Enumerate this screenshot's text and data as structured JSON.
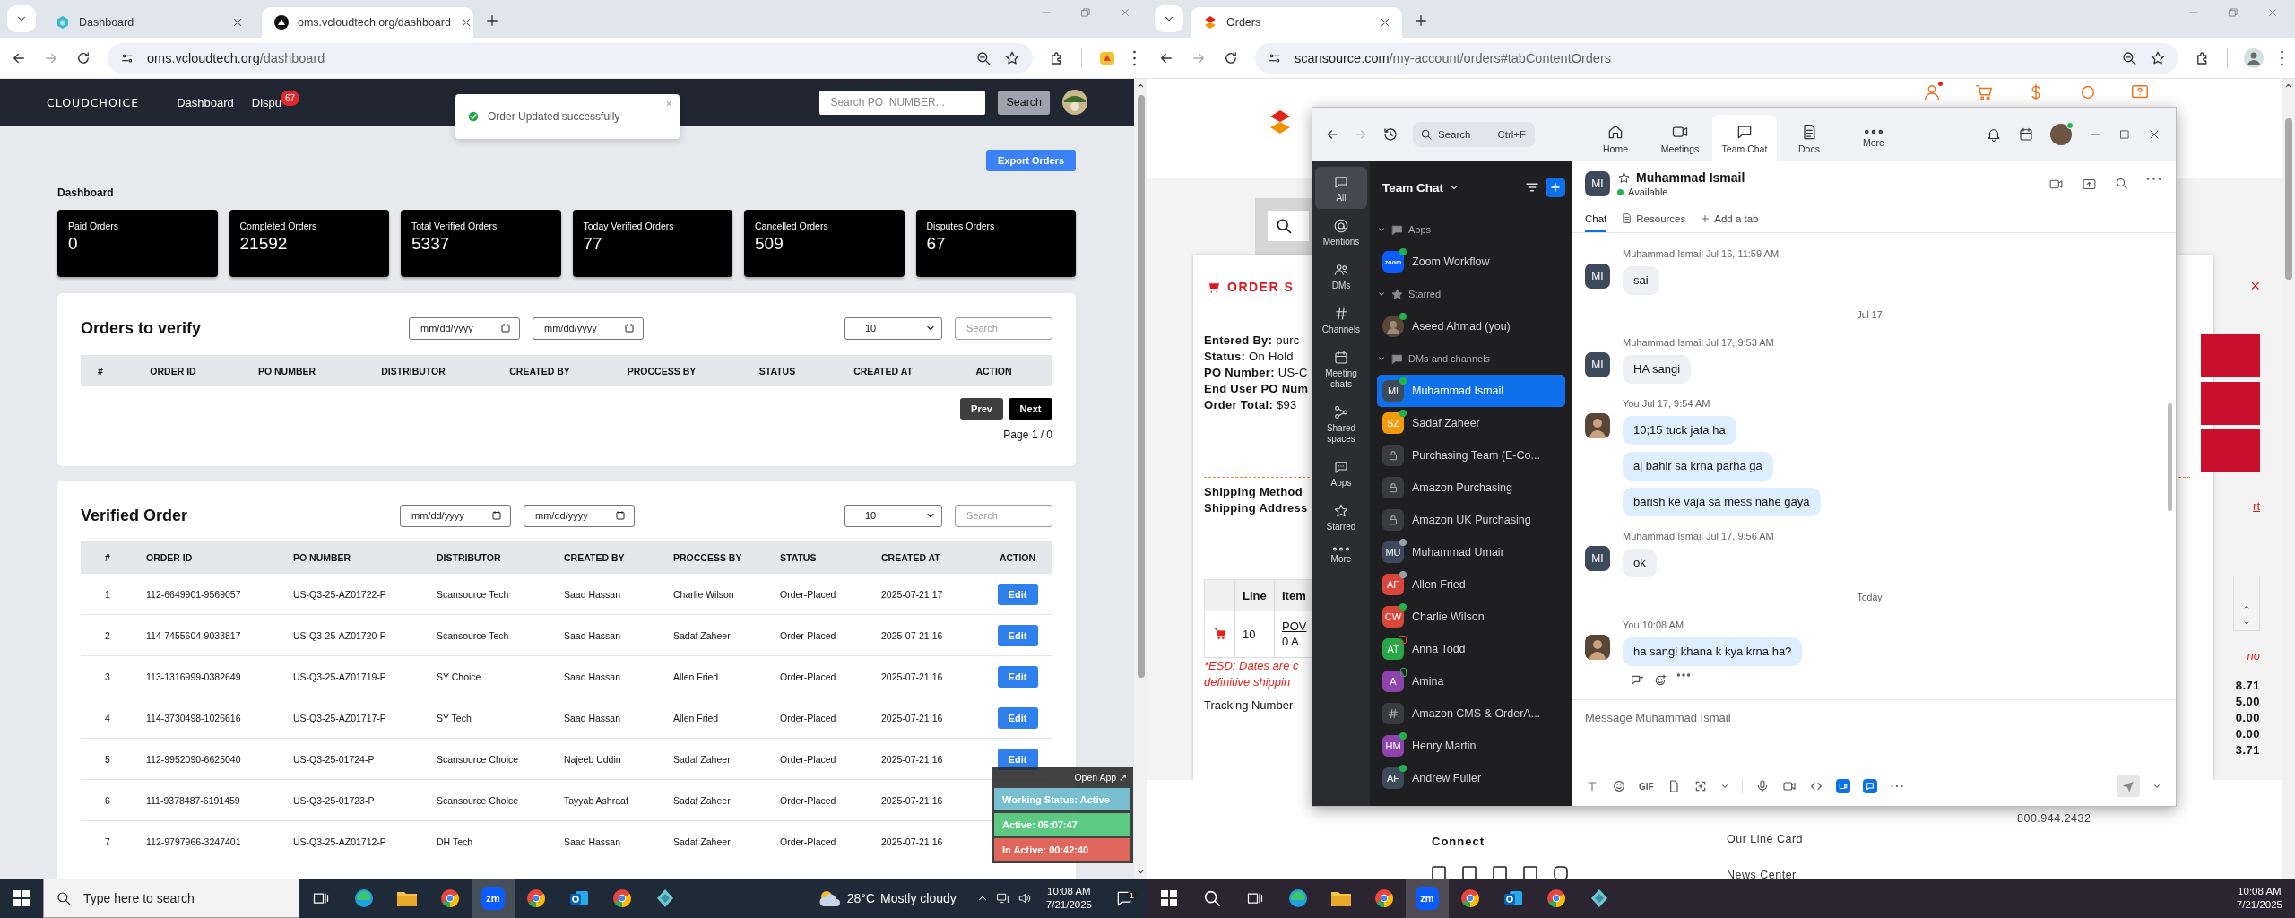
{
  "left_browser": {
    "tabs": [
      {
        "title": "Dashboard",
        "selected": false,
        "kind": "hexagon"
      },
      {
        "title": "oms.vcloudtech.org/dashboard",
        "selected": true,
        "kind": "triangle"
      }
    ],
    "address": {
      "host": "oms.vcloudtech.org",
      "path": "/dashboard"
    }
  },
  "oms": {
    "logo": "CLOUDCHOICE",
    "nav": [
      {
        "label": "Dashboard"
      },
      {
        "label": "Dispu",
        "badge": "67"
      }
    ],
    "search": {
      "placeholder": "Search PO_NUMBER...",
      "button": "Search"
    },
    "toast": {
      "message": "Order Updated successfully",
      "close": "×"
    },
    "export_button": "Export Orders",
    "heading": "Dashboard",
    "stats": [
      {
        "label": "Paid Orders",
        "value": "0"
      },
      {
        "label": "Completed Orders",
        "value": "21592"
      },
      {
        "label": "Total Verified Orders",
        "value": "5337"
      },
      {
        "label": "Today Verified Orders",
        "value": "77"
      },
      {
        "label": "Cancelled Orders",
        "value": "509"
      },
      {
        "label": "Disputes Orders",
        "value": "67"
      }
    ],
    "orders_to_verify": {
      "title": "Orders to verify",
      "date_from": {
        "placeholder": "mm/dd/yyyy"
      },
      "date_to": {
        "placeholder": "mm/dd/yyyy"
      },
      "page_size": "10",
      "search": {
        "placeholder": "Search"
      },
      "columns": [
        "#",
        "ORDER ID",
        "PO NUMBER",
        "DISTRIBUTOR",
        "CREATED BY",
        "PROCCESS BY",
        "STATUS",
        "CREATED AT",
        "ACTION"
      ],
      "prev": "Prev",
      "next": "Next",
      "page_info": "Page 1 / 0"
    },
    "verified_orders": {
      "title": "Verified Order",
      "date_from": {
        "placeholder": "mm/dd/yyyy"
      },
      "date_to": {
        "placeholder": "mm/dd/yyyy"
      },
      "page_size": "10",
      "search": {
        "placeholder": "Search"
      },
      "columns": [
        "#",
        "ORDER ID",
        "PO NUMBER",
        "DISTRIBUTOR",
        "CREATED BY",
        "PROCCESS BY",
        "STATUS",
        "CREATED AT",
        "ACTION"
      ],
      "rows": [
        {
          "number": "1",
          "order_id": "112-6649901-9569057",
          "po_number": "US-Q3-25-AZ01722-P",
          "distributor": "Scansource Tech",
          "created_by": "Saad Hassan",
          "processed_by": "Charlie Wilson",
          "status": "Order-Placed",
          "created_at": "2025-07-21 17",
          "action": "Edit"
        },
        {
          "number": "2",
          "order_id": "114-7455604-9033817",
          "po_number": "US-Q3-25-AZ01720-P",
          "distributor": "Scansource Tech",
          "created_by": "Saad Hassan",
          "processed_by": "Sadaf Zaheer",
          "status": "Order-Placed",
          "created_at": "2025-07-21 16",
          "action": "Edit"
        },
        {
          "number": "3",
          "order_id": "113-1316999-0382649",
          "po_number": "US-Q3-25-AZ01719-P",
          "distributor": "SY Choice",
          "created_by": "Saad Hassan",
          "processed_by": "Allen Fried",
          "status": "Order-Placed",
          "created_at": "2025-07-21 16",
          "action": "Edit"
        },
        {
          "number": "4",
          "order_id": "114-3730498-1026616",
          "po_number": "US-Q3-25-AZ01717-P",
          "distributor": "SY Tech",
          "created_by": "Saad Hassan",
          "processed_by": "Allen Fried",
          "status": "Order-Placed",
          "created_at": "2025-07-21 16",
          "action": "Edit"
        },
        {
          "number": "5",
          "order_id": "112-9952090-6625040",
          "po_number": "US-Q3-25-01724-P",
          "distributor": "Scansource Choice",
          "created_by": "Najeeb Uddin",
          "processed_by": "Sadaf Zaheer",
          "status": "Order-Placed",
          "created_at": "2025-07-21 16",
          "action": "Edit"
        },
        {
          "number": "6",
          "order_id": "111-9378487-6191459",
          "po_number": "US-Q3-25-01723-P",
          "distributor": "Scansource Choice",
          "created_by": "Tayyab Ashraaf",
          "processed_by": "Sadaf Zaheer",
          "status": "Order-Placed",
          "created_at": "2025-07-21 16"
        },
        {
          "number": "7",
          "order_id": "112-9797966-3247401",
          "po_number": "US-Q3-25-AZ01712-P",
          "distributor": "DH Tech",
          "created_by": "Saad Hassan",
          "processed_by": "Sadaf Zaheer",
          "status": "Order-Placed",
          "created_at": "2025-07-21 16"
        }
      ]
    },
    "activity_widget": {
      "open_app": "Open App ↗",
      "working_status": "Working Status: Active",
      "active": "Active: 06:07:47",
      "inactive": "In Active: 00:42:40"
    }
  },
  "right_browser": {
    "tabs": [
      {
        "title": "Orders",
        "selected": true,
        "kind": "scansource"
      }
    ],
    "address": {
      "host": "scansource.com",
      "path": "/my-account/orders#tabContentOrders"
    }
  },
  "scansource": {
    "order_title": "ORDER S",
    "close": "×",
    "details": [
      {
        "label": "Entered By:",
        "value": "purc"
      },
      {
        "label": "Status:",
        "value": "On Hold"
      },
      {
        "label": "PO Number:",
        "value": "US-C"
      },
      {
        "label": "End User PO Num"
      },
      {
        "label": "Order Total:",
        "value": "$93"
      }
    ],
    "shipping": [
      "Shipping Method",
      "Shipping Address"
    ],
    "link_fragment": "rt",
    "table": {
      "columns": [
        "Line",
        "Item"
      ],
      "rows": [
        {
          "line": "10",
          "item": "POV",
          "item_note": "0 A"
        }
      ]
    },
    "esd_note": [
      "*ESD: Dates are c",
      "definitive shippin"
    ],
    "right_note": "no",
    "tracking": "Tracking Number",
    "totals": [
      "8.71",
      "5.00",
      "0.00",
      "0.00",
      "3.71"
    ],
    "phone": "800.944.2432",
    "connect": "Connect",
    "footer_links": [
      "Our Line Card",
      "News Center"
    ]
  },
  "zoom": {
    "search": {
      "placeholder": "Search",
      "shortcut": "Ctrl+F"
    },
    "tabs": [
      {
        "label": "Home",
        "kind": "home",
        "selected": false
      },
      {
        "label": "Meetings",
        "kind": "video",
        "selected": false
      },
      {
        "label": "Team Chat",
        "kind": "chat",
        "selected": true
      },
      {
        "label": "Docs",
        "kind": "doc",
        "selected": false
      },
      {
        "label": "More",
        "kind": "more",
        "selected": false
      }
    ],
    "rail": [
      {
        "label": "All",
        "kind": "chat",
        "selected": true
      },
      {
        "label": "Mentions",
        "kind": "at",
        "selected": false
      },
      {
        "label": "DMs",
        "kind": "people",
        "selected": false
      },
      {
        "label": "Channels",
        "kind": "hash",
        "selected": false
      },
      {
        "label": "Meeting chats",
        "kind": "calendar",
        "selected": false
      },
      {
        "label": "Shared spaces",
        "kind": "share",
        "selected": false
      },
      {
        "label": "Apps",
        "kind": "apps",
        "selected": false
      },
      {
        "label": "Starred",
        "kind": "star",
        "selected": false
      },
      {
        "label": "More",
        "kind": "more",
        "selected": false
      }
    ],
    "sidebar": {
      "title": "Team Chat",
      "sections": [
        {
          "title": "Apps",
          "kind": "apps",
          "items": [
            {
              "name": "Zoom Workflow",
              "kind": "app",
              "initials": "zoom",
              "color": "#0b5cff",
              "presence": {
                "kind": "online",
                "color": "#21b34b"
              },
              "selected": false
            }
          ]
        },
        {
          "title": "Starred",
          "kind": "star",
          "items": [
            {
              "name": "Aseed Ahmad (you)",
              "kind": "photo",
              "presence": {
                "kind": "online",
                "color": "#21b34b"
              },
              "selected": false
            }
          ]
        },
        {
          "title": "DMs and channels",
          "kind": "chat",
          "items": [
            {
              "name": "Muhammad Ismail",
              "kind": "avatar",
              "initials": "MI",
              "color": "#3d4a5c",
              "presence": {
                "kind": "online",
                "color": "#21b34b"
              },
              "selected": true
            },
            {
              "name": "Sadaf Zaheer",
              "kind": "avatar",
              "initials": "SZ",
              "color": "#f29b0c",
              "presence": {
                "kind": "online",
                "color": "#21b34b"
              },
              "selected": false
            },
            {
              "name": "Purchasing Team (E-Co...",
              "kind": "private",
              "selected": false
            },
            {
              "name": "Amazon Purchasing",
              "kind": "private",
              "selected": false
            },
            {
              "name": "Amazon UK Purchasing",
              "kind": "private",
              "selected": false
            },
            {
              "name": "Muhammad Umair",
              "kind": "avatar",
              "initials": "MU",
              "color": "#3d4a5c",
              "presence": {
                "kind": "away",
                "color": "#9aa0a6"
              },
              "selected": false
            },
            {
              "name": "Allen Fried",
              "kind": "avatar",
              "initials": "AF",
              "color": "#d9453b",
              "presence": {
                "kind": "away",
                "color": "#9aa0a6"
              },
              "selected": false
            },
            {
              "name": "Charlie Wilson",
              "kind": "avatar",
              "initials": "CW",
              "color": "#d9453b",
              "presence": {
                "kind": "online",
                "color": "#21b34b"
              },
              "selected": false
            },
            {
              "name": "Anna Todd",
              "kind": "avatar",
              "initials": "AT",
              "color": "#27a745",
              "presence": {
                "kind": "meeting",
                "color": "#e0433a"
              },
              "selected": false
            },
            {
              "name": "Amina",
              "kind": "avatar",
              "initials": "A",
              "color": "#8e44ad",
              "presence": {
                "kind": "mobile",
                "color": "#21b34b"
              },
              "selected": false
            },
            {
              "name": "Amazon CMS & OrderA...",
              "kind": "channel",
              "selected": false
            },
            {
              "name": "Henry Martin",
              "kind": "avatar",
              "initials": "HM",
              "color": "#8e44ad",
              "presence": {
                "kind": "online",
                "color": "#21b34b"
              },
              "selected": false
            },
            {
              "name": "Andrew Fuller",
              "kind": "avatar",
              "initials": "AF",
              "color": "#3d4a5c",
              "presence": {
                "kind": "online",
                "color": "#21b34b"
              },
              "selected": false
            }
          ]
        }
      ]
    },
    "chat": {
      "contact": {
        "initials": "MI",
        "name": "Muhammad Ismail",
        "status": "Available"
      },
      "tabs": [
        {
          "label": "Chat",
          "selected": true
        },
        {
          "label": "Resources",
          "selected": false
        }
      ],
      "add_tab": "Add a tab",
      "messages": [
        {
          "kind": "message",
          "sender": "Muhammad Ismail",
          "time": "Jul 16, 11:59 AM",
          "from_me": false,
          "initials": "MI",
          "bubbles": [
            "sai"
          ]
        },
        {
          "kind": "date",
          "label": "Jul 17"
        },
        {
          "kind": "message",
          "sender": "Muhammad Ismail",
          "time": "Jul 17, 9:53 AM",
          "from_me": false,
          "initials": "MI",
          "bubbles": [
            "HA sangi"
          ]
        },
        {
          "kind": "message",
          "sender": "You",
          "time": "Jul 17, 9:54 AM",
          "from_me": true,
          "bubbles": [
            "10;15 tuck jata ha",
            "aj bahir sa krna parha ga",
            "barish ke vaja sa mess nahe gaya"
          ]
        },
        {
          "kind": "message",
          "sender": "Muhammad Ismail",
          "time": "Jul 17, 9:56 AM",
          "from_me": false,
          "initials": "MI",
          "bubbles": [
            "ok"
          ]
        },
        {
          "kind": "date",
          "label": "Today"
        },
        {
          "kind": "message",
          "sender": "You",
          "time": "10:08 AM",
          "from_me": true,
          "bubbles": [
            "ha sangi khana k kya krna ha?"
          ],
          "show_actions": true
        }
      ],
      "composer": {
        "placeholder": "Message Muhammad Ismail",
        "gif": "GIF"
      }
    }
  },
  "taskbars": [
    {
      "search_placeholder": "Type here to search",
      "apps": [
        {
          "kind": "taskview",
          "active": false
        },
        {
          "kind": "edge",
          "active": false
        },
        {
          "kind": "explorer",
          "active": false
        },
        {
          "kind": "chrome",
          "active": false
        },
        {
          "kind": "zoom",
          "label": "zm",
          "active": true
        },
        {
          "kind": "chrome",
          "active": false
        },
        {
          "kind": "outlook",
          "active": false
        },
        {
          "kind": "chrome",
          "active": false
        },
        {
          "kind": "app",
          "active": false
        }
      ],
      "weather": {
        "temperature": "28°C",
        "condition": "Mostly cloudy"
      },
      "time": "10:08 AM",
      "date": "7/21/2025",
      "notification_count": "1"
    },
    {
      "apps": [
        {
          "kind": "search",
          "active": false
        },
        {
          "kind": "taskview",
          "active": false
        },
        {
          "kind": "edge",
          "active": false
        },
        {
          "kind": "explorer",
          "active": false
        },
        {
          "kind": "chrome",
          "active": false
        },
        {
          "kind": "zoom",
          "label": "zm",
          "active": true
        },
        {
          "kind": "chrome",
          "active": false
        },
        {
          "kind": "outlook",
          "active": false
        },
        {
          "kind": "chrome",
          "active": false
        },
        {
          "kind": "app",
          "active": false
        }
      ],
      "time": "10:08 AM",
      "date": "7/21/2025"
    }
  ]
}
